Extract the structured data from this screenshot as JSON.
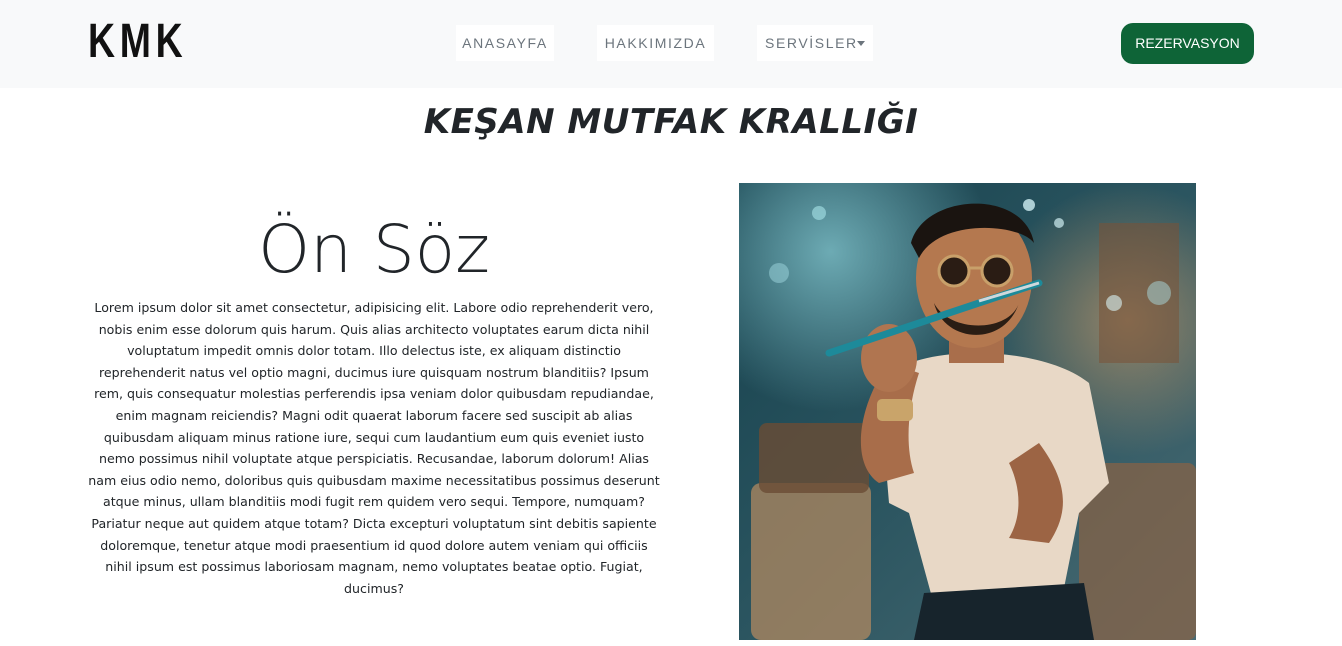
{
  "navbar": {
    "brand": "KMK",
    "links": [
      {
        "label": "ANASAYFA"
      },
      {
        "label": "HAKKIMIZDA"
      },
      {
        "label": "SERVİSLER"
      }
    ],
    "reserve_label": "REZERVASYON"
  },
  "hero": {
    "title": "KEŞAN MUTFAK KRALLIĞI"
  },
  "intro": {
    "heading": "Ön Söz",
    "paragraph": "Lorem ipsum dolor sit amet consectetur, adipisicing elit. Labore odio reprehenderit vero, nobis enim esse dolorum quis harum. Quis alias architecto voluptates earum dicta nihil voluptatum impedit omnis dolor totam. Illo delectus iste, ex aliquam distinctio reprehenderit natus vel optio magni, ducimus iure quisquam nostrum blanditiis? Ipsum rem, quis consequatur molestias perferendis ipsa veniam dolor quibusdam repudiandae, enim magnam reiciendis? Magni odit quaerat laborum facere sed suscipit ab alias quibusdam aliquam minus ratione iure, sequi cum laudantium eum quis eveniet iusto nemo possimus nihil voluptate atque perspiciatis. Recusandae, laborum dolorum! Alias nam eius odio nemo, doloribus quis quibusdam maxime necessitatibus possimus deserunt atque minus, ullam blanditiis modi fugit rem quidem vero sequi. Tempore, numquam? Pariatur neque aut quidem atque totam? Dicta excepturi voluptatum sint debitis sapiente doloremque, tenetur atque modi praesentium id quod dolore autem veniam qui officiis nihil ipsum est possimus laboriosam magnam, nemo voluptates beatae optio. Fugiat, ducimus?"
  },
  "colors": {
    "navbar_bg": "#f8f9fa",
    "reserve_bg": "#0e6437",
    "nav_text": "#6c757d",
    "text": "#212529"
  },
  "icons": {
    "dropdown": "caret-down-icon"
  }
}
